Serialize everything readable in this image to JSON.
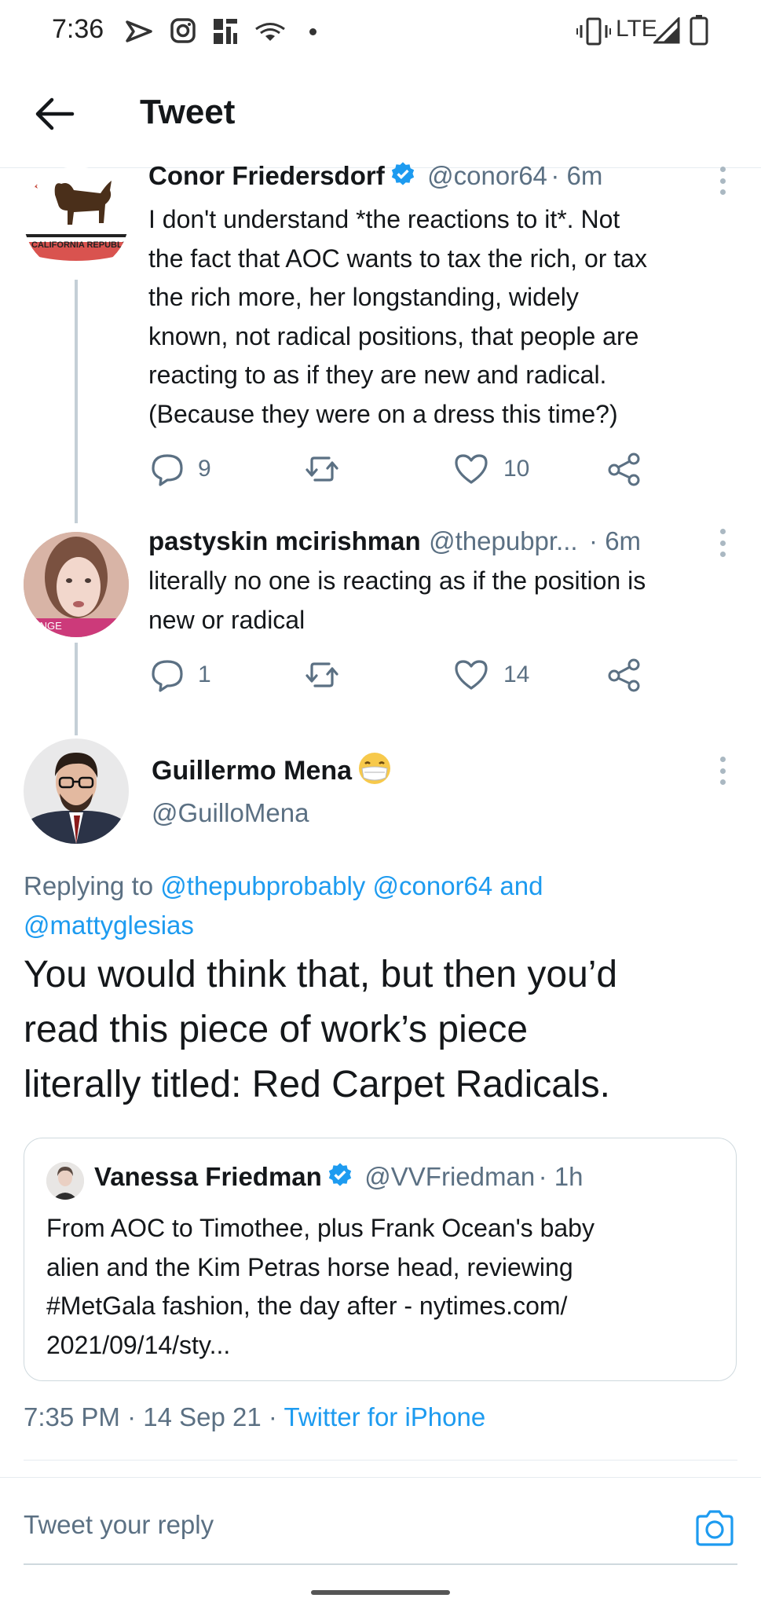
{
  "status_bar": {
    "time": "7:36",
    "network": "LTE"
  },
  "header": {
    "title": "Tweet"
  },
  "tweets": [
    {
      "name": "Conor Friedersdorf",
      "handle": "@conor64",
      "time": "· 6m",
      "avatar_icon": "california-republic-flag-avatar",
      "avatar_text": "CALIFORNIA REPUBLIC",
      "verified": true,
      "lines": [
        "I don't understand *the reactions to it*. Not",
        "the fact that AOC wants to tax the rich, or tax",
        "the rich more, her longstanding, widely",
        "known, not radical positions, that people are",
        "reacting to as if they are new and radical.",
        "(Because they were on a dress this time?)"
      ],
      "replies": "9",
      "retweets": "",
      "likes": "10"
    },
    {
      "name": "pastyskin mcirishman",
      "handle": "@thepubpr...",
      "time": "· 6m",
      "avatar_icon": "person-photo-avatar",
      "avatar_text": "ANGE",
      "verified": false,
      "lines": [
        "literally no one is reacting as if the position is",
        "new or radical"
      ],
      "replies": "1",
      "retweets": "",
      "likes": "14"
    }
  ],
  "main_tweet": {
    "name": "Guillermo Mena",
    "emoji_icon": "face-with-mask-emoji-icon",
    "handle": "@GuilloMena",
    "replying_prefix": "Replying to",
    "replying_users": [
      "@thepubprobably",
      "@conor64"
    ],
    "replying_and": "and",
    "replying_last": "@mattyglesias",
    "lines": [
      "You would think that, but then you’d",
      "read this piece of work’s piece",
      "literally titled: Red Carpet Radicals."
    ],
    "timestamp": "7:35 PM · 14 Sep 21 ·",
    "source": "Twitter for iPhone"
  },
  "quoted_tweet": {
    "name": "Vanessa Friedman",
    "handle": "@VVFriedman",
    "time": "· 1h",
    "verified": true,
    "lines": [
      "From AOC to Timothee, plus Frank Ocean's baby",
      "alien and the Kim Petras horse head, reviewing",
      "#MetGala fashion, the day after - nytimes.com/",
      "2021/09/14/sty..."
    ]
  },
  "reply_bar": {
    "placeholder": "Tweet your reply"
  },
  "colors": {
    "link": "#1d9bf0",
    "text": "#14171a",
    "secondary": "#5b7083",
    "verified": "#1d9bf0"
  }
}
